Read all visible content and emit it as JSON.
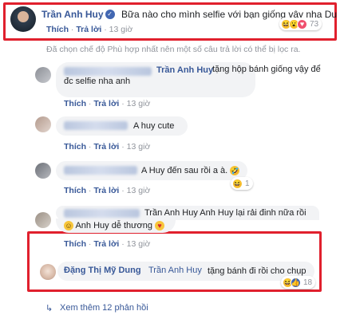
{
  "main_comment": {
    "author": "Trần Anh Huy",
    "text": "Bữa nào cho mình selfie với bạn giống vậy nha Du",
    "actions": {
      "like": "Thích",
      "reply": "Trả lời",
      "time": "13 giờ"
    },
    "reactions_count": "73"
  },
  "filter_notice": "Đã chọn chế độ Phù hợp nhất nên một số câu trả lời có thể bị lọc ra.",
  "replies": [
    {
      "author": "",
      "mention": "Trần Anh Huy",
      "text_line1": "tặng hộp bánh giống vậy để",
      "text_line2": "đc selfie nha anh",
      "actions": {
        "like": "Thích",
        "reply": "Trả lời",
        "time": "13 giờ"
      }
    },
    {
      "author": "",
      "text": "A huy cute",
      "actions": {
        "like": "Thích",
        "reply": "Trả lời",
        "time": "13 giờ"
      }
    },
    {
      "author": "",
      "text": "A Huy đến sau rồi a à.",
      "actions": {
        "like": "Thích",
        "reply": "Trả lời",
        "time": "13 giờ"
      },
      "reactions_count": "1"
    },
    {
      "author": "",
      "text_line1": "Trần Anh Huy Anh Huy lại rải đinh nữa rồi",
      "text_line2": "Anh Huy dễ thương",
      "actions": {
        "like": "Thích",
        "reply": "Trả lời",
        "time": "13 giờ"
      }
    },
    {
      "author": "Đặng Thị Mỹ Dung",
      "mention": "Trần Anh Huy",
      "text": "tặng bánh đi rồi cho chụp",
      "reactions_count": "18"
    }
  ],
  "view_more": "Xem thêm 12 phản hồi",
  "colors": {
    "highlight": "#e0202d",
    "link": "#385898",
    "meta": "#90949c"
  }
}
